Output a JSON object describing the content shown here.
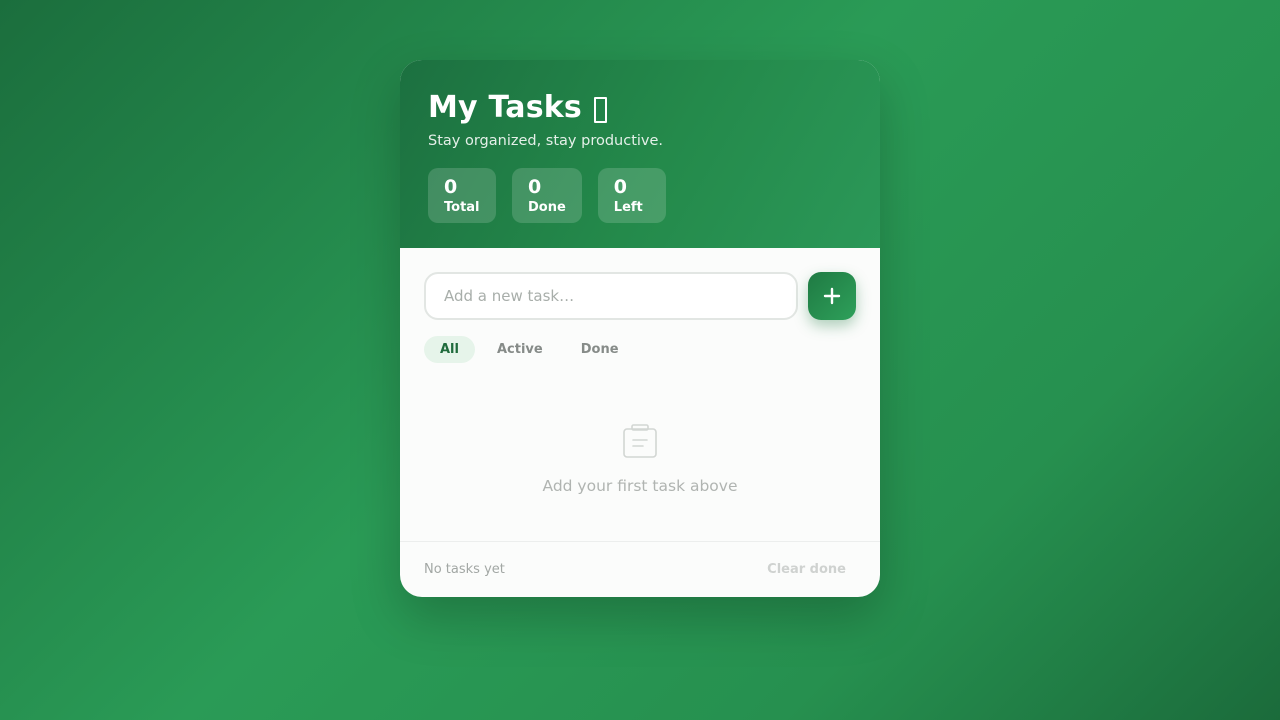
{
  "header": {
    "title": "My Tasks",
    "title_icon": "clipboard-emoji-icon",
    "subtitle": "Stay organized, stay productive."
  },
  "stats": [
    {
      "value": "0",
      "label": "Total"
    },
    {
      "value": "0",
      "label": "Done"
    },
    {
      "value": "0",
      "label": "Left"
    }
  ],
  "input": {
    "placeholder": "Add a new task…",
    "value": "",
    "add_icon": "plus-icon"
  },
  "tabs": [
    {
      "label": "All",
      "active": true
    },
    {
      "label": "Active",
      "active": false
    },
    {
      "label": "Done",
      "active": false
    }
  ],
  "empty_state": {
    "icon": "clipboard-icon",
    "text": "Add your first task above"
  },
  "footer": {
    "status": "No tasks yet",
    "clear_label": "Clear done"
  },
  "colors": {
    "accent": "#248a4b",
    "accent_dark": "#1c7040",
    "tab_active_bg": "#e6f4ea",
    "tab_active_text": "#1f6b3c"
  }
}
